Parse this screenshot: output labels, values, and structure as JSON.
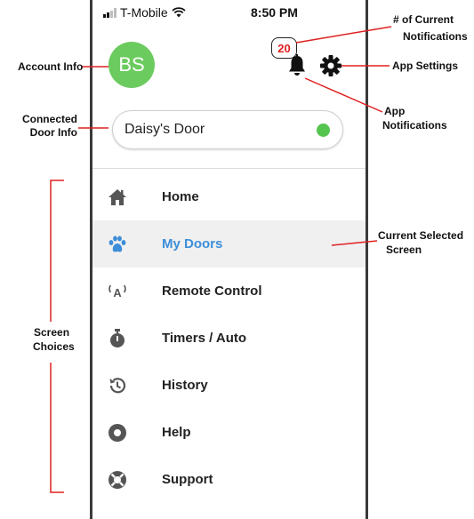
{
  "status_bar": {
    "carrier": "T-Mobile",
    "time": "8:50 PM"
  },
  "account": {
    "initials": "BS"
  },
  "notifications": {
    "count": "20"
  },
  "door": {
    "name": "Daisy's Door",
    "status_color": "#55c550"
  },
  "nav": {
    "items": [
      {
        "label": "Home",
        "icon": "home-icon"
      },
      {
        "label": "My Doors",
        "icon": "paw-icon",
        "selected": true
      },
      {
        "label": "Remote Control",
        "icon": "remote-antenna-icon"
      },
      {
        "label": "Timers / Auto",
        "icon": "stopwatch-icon"
      },
      {
        "label": "History",
        "icon": "history-icon"
      },
      {
        "label": "Help",
        "icon": "help-circle-icon"
      },
      {
        "label": "Support",
        "icon": "lifebuoy-icon"
      }
    ]
  },
  "annotations": {
    "account_info": "Account Info",
    "connected_door_line1": "Connected",
    "connected_door_line2": "Door Info",
    "num_notifications_line1": "# of Current",
    "num_notifications_line2": "Notifications",
    "app_settings": "App Settings",
    "app_notifications_line1": "App",
    "app_notifications_line2": "Notifications",
    "current_screen_line1": "Current Selected",
    "current_screen_line2": "Screen",
    "screen_choices_line1": "Screen",
    "screen_choices_line2": "Choices"
  },
  "colors": {
    "accent": "#3d8ed9",
    "avatar": "#6ccb5f",
    "annotation": "#e02020"
  }
}
